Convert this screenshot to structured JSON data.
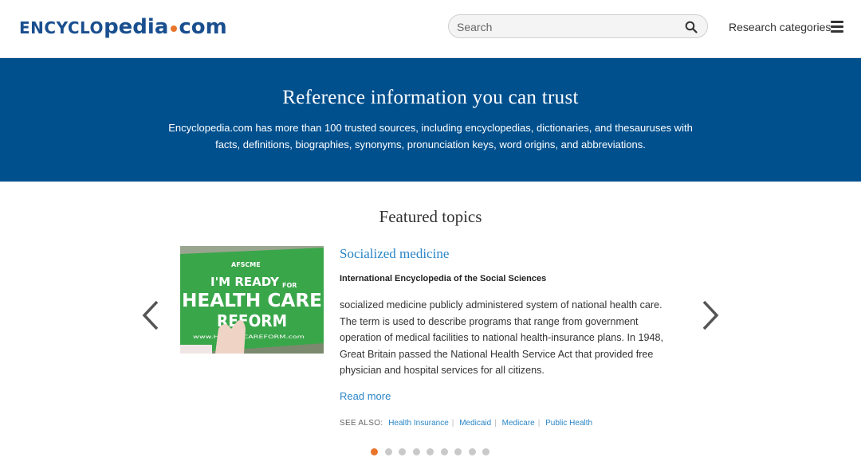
{
  "header": {
    "logo": {
      "part1": "ENCYCLO",
      "part2": "pedia",
      "part3": "com"
    },
    "search_placeholder": "Search",
    "research_label": "Research categories"
  },
  "banner": {
    "title": "Reference information you can trust",
    "description": "Encyclopedia.com has more than 100 trusted sources, including encyclopedias, dictionaries, and thesauruses with facts, definitions, biographies, synonyms, pronunciation keys, word origins, and abbreviations."
  },
  "featured": {
    "heading": "Featured topics",
    "topic": {
      "title": "Socialized medicine",
      "source": "International Encyclopedia of the Social Sciences",
      "text": "socialized medicine publicly administered system of national health care. The term is used to describe programs that range from government operation of medical facilities to national health-insurance plans. In 1948, Great Britain passed the National Health Service Act that provided free physician and hospital services for all citizens.",
      "read_more": "Read more",
      "see_also_label": "SEE ALSO:",
      "see_also": [
        "Health Insurance",
        "Medicaid",
        "Medicare",
        "Public Health"
      ],
      "image_sign": {
        "org": "AFSCME",
        "line1": "I'M READY",
        "line1b": "FOR",
        "line2": "HEALTH CARE",
        "line3": "REFORM",
        "url": "www.HEALTHCAREFORM.com"
      }
    },
    "carousel": {
      "count": 9,
      "active_index": 1
    }
  },
  "icons": {
    "search": "search-icon",
    "menu": "hamburger-menu-icon",
    "prev": "chevron-left-icon",
    "next": "chevron-right-icon"
  },
  "colors": {
    "brand_blue": "#1a4f8f",
    "banner_blue": "#00508e",
    "link_blue": "#2a86c7",
    "accent_orange": "#e8752b"
  }
}
